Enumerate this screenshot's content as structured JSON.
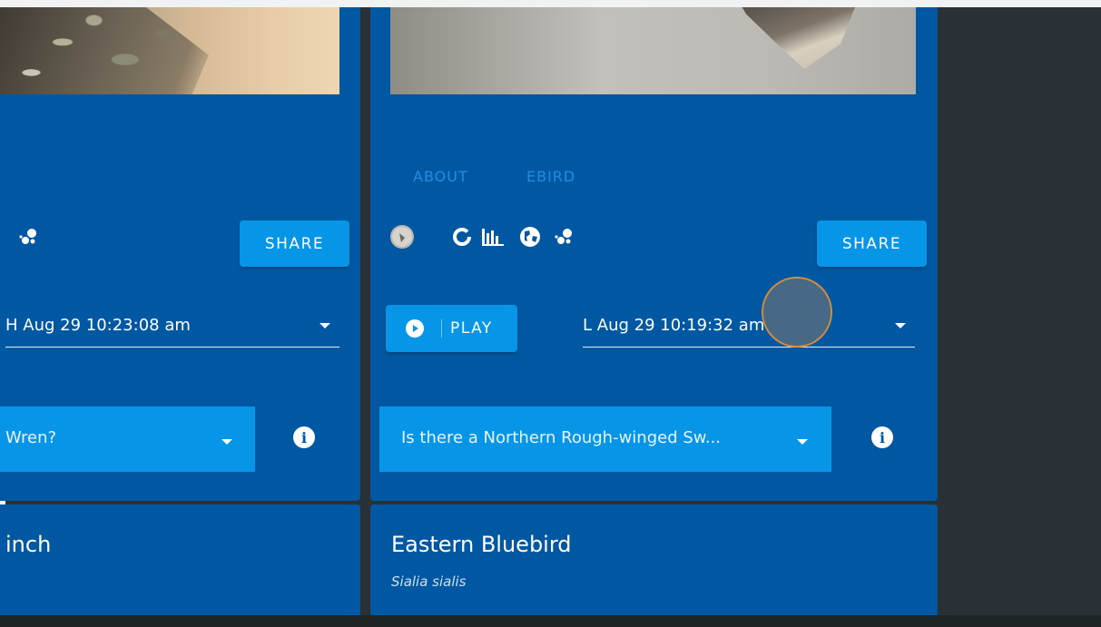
{
  "left_card": {
    "share_label": "SHARE",
    "select_value": "H Aug 29 10:23:08 am",
    "question": "Wren?"
  },
  "right_card": {
    "tabs": [
      "ABOUT",
      "EBIRD"
    ],
    "share_label": "SHARE",
    "play_label": "PLAY",
    "select_value": "L Aug 29 10:19:32 am",
    "question": "Is there a Northern Rough-winged Sw...",
    "icons": [
      "bird-avatar-icon",
      "donut-chart-icon",
      "bar-chart-icon",
      "globe-icon",
      "scatter-dots-icon"
    ]
  },
  "bottom_left": {
    "title": "inch"
  },
  "bottom_right": {
    "title": "Eastern Bluebird",
    "scientific": "Sialia sialis"
  },
  "colors": {
    "card": "#0058a3",
    "button": "#0795e8",
    "tab": "#1f8fe0",
    "background": "#2a3136"
  }
}
